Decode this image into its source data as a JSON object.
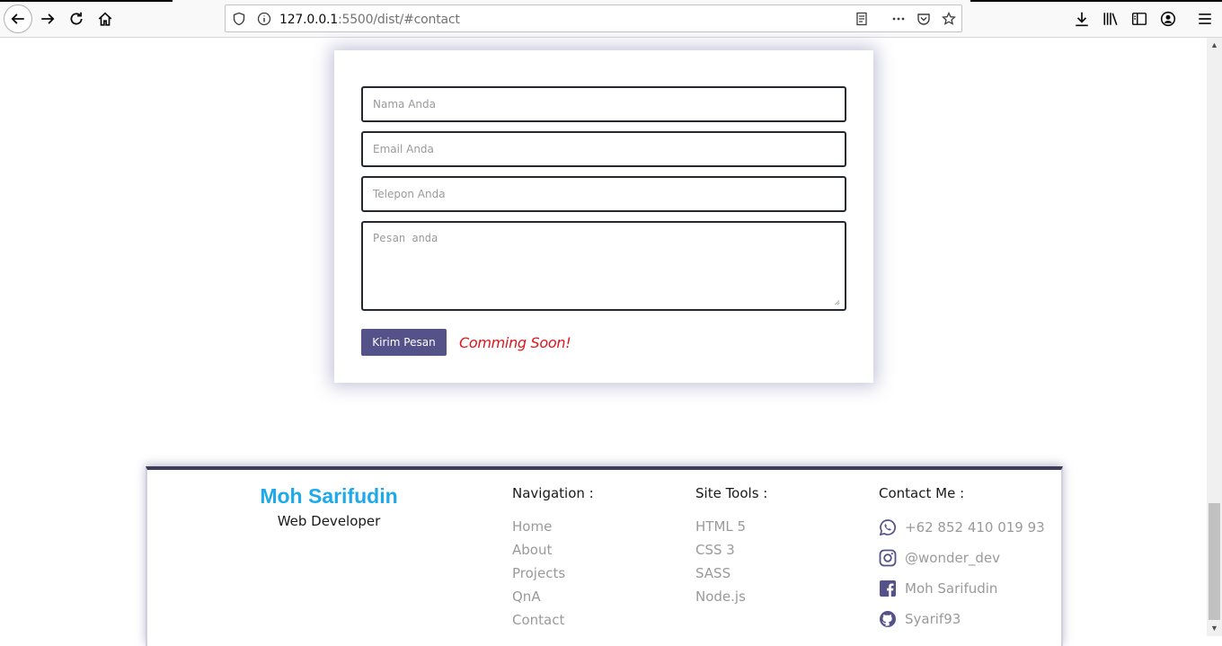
{
  "browser": {
    "url_host": "127.0.0.1",
    "url_rest": ":5500/dist/#contact"
  },
  "form": {
    "name_placeholder": "Nama Anda",
    "email_placeholder": "Email Anda",
    "phone_placeholder": "Telepon Anda",
    "message_placeholder": "Pesan anda",
    "submit_label": "Kirim Pesan",
    "note": "Comming Soon!"
  },
  "footer": {
    "name": "Moh Sarifudin",
    "role": "Web Developer",
    "navigation": {
      "title": "Navigation :",
      "links": [
        "Home",
        "About",
        "Projects",
        "QnA",
        "Contact"
      ]
    },
    "tools": {
      "title": "Site Tools :",
      "items": [
        "HTML 5",
        "CSS 3",
        "SASS",
        "Node.js"
      ]
    },
    "contact": {
      "title": "Contact Me :",
      "items": [
        {
          "icon": "whatsapp-icon",
          "text": "+62 852 410 019 93"
        },
        {
          "icon": "instagram-icon",
          "text": "@wonder_dev"
        },
        {
          "icon": "facebook-icon",
          "text": "Moh Sarifudin"
        },
        {
          "icon": "github-icon",
          "text": "Syarif93"
        }
      ]
    }
  },
  "colors": {
    "accent": "#55528a",
    "brand": "#1da9ea",
    "warning": "#e0161e"
  }
}
